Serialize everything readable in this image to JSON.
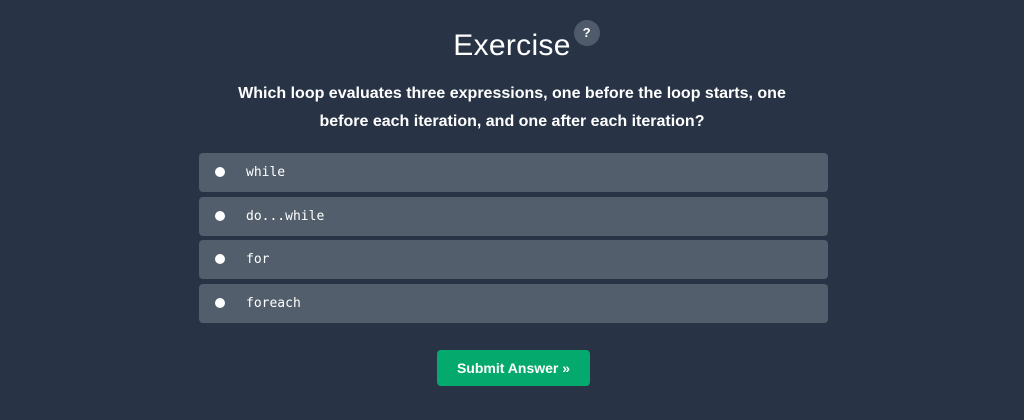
{
  "header": {
    "title": "Exercise",
    "help_label": "?"
  },
  "question": {
    "text": "Which loop evaluates three expressions, one before the loop starts, one before each iteration, and one after each iteration?"
  },
  "options": [
    {
      "label": "while"
    },
    {
      "label": "do...while"
    },
    {
      "label": "for"
    },
    {
      "label": "foreach"
    }
  ],
  "submit": {
    "label": "Submit Answer »"
  },
  "colors": {
    "background": "#283446",
    "option_bg": "#525e6c",
    "submit_bg": "#04aa6d"
  }
}
